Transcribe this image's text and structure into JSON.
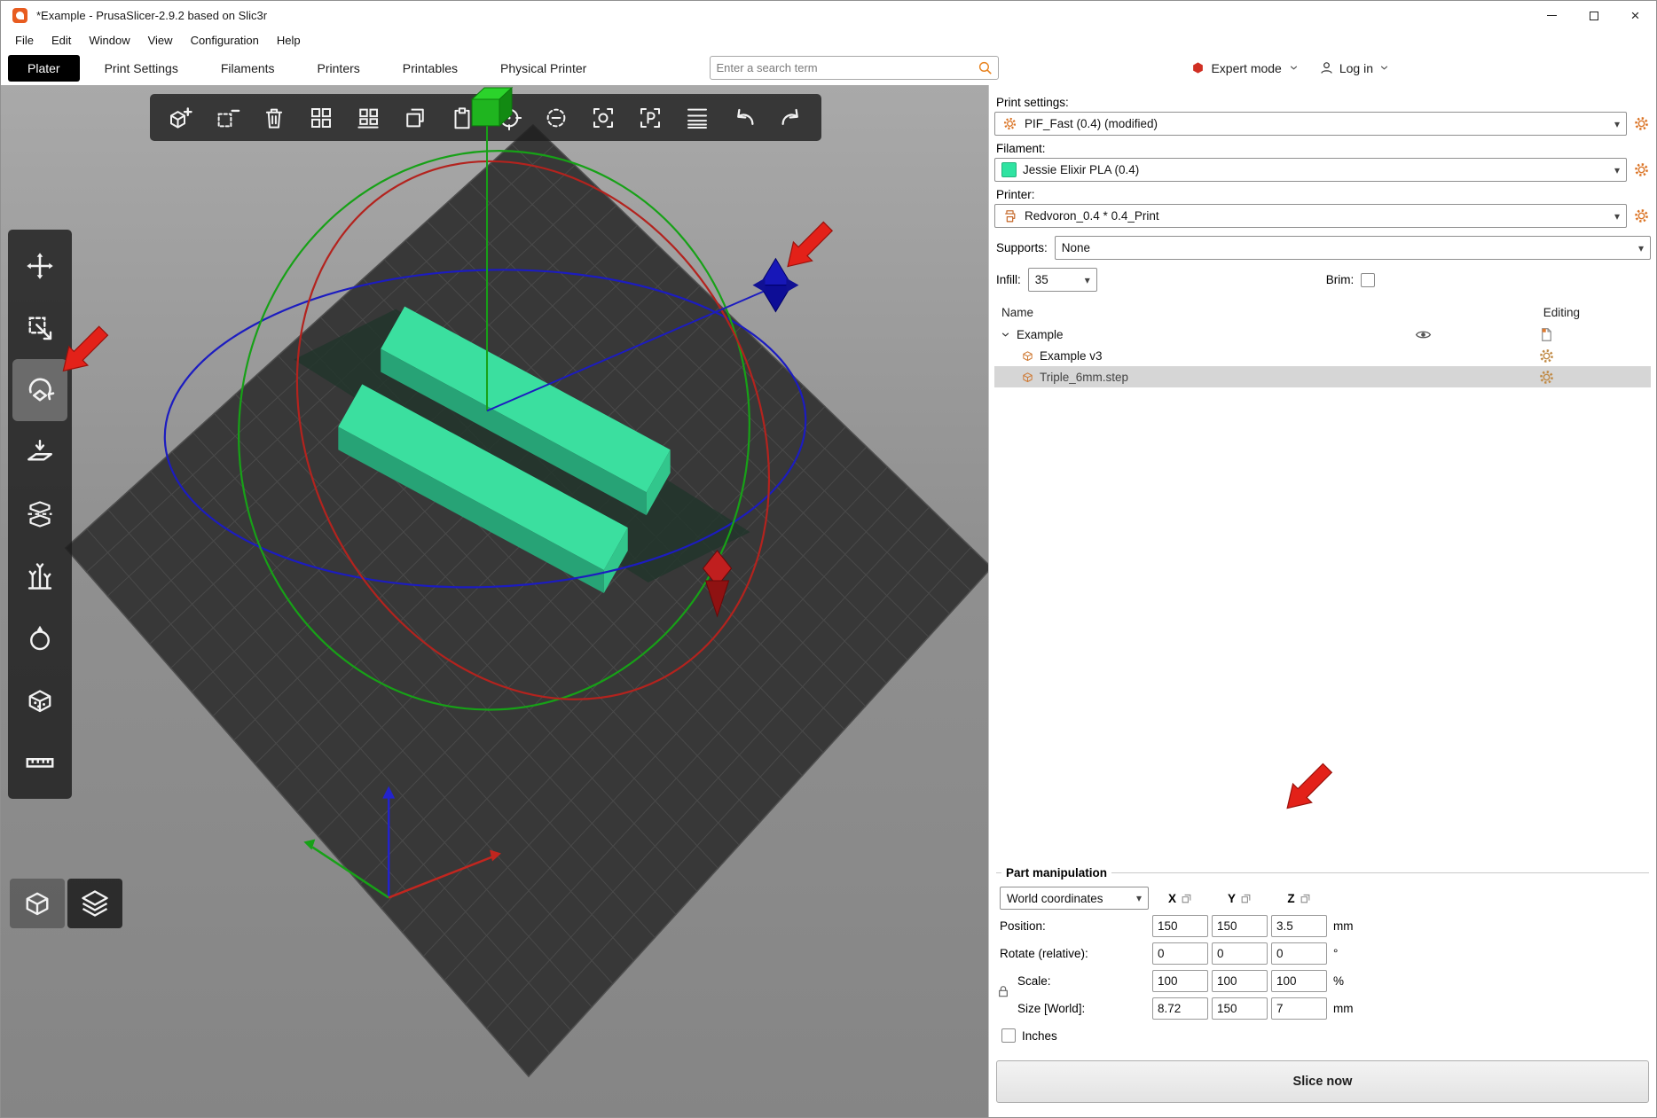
{
  "window": {
    "title": "*Example - PrusaSlicer-2.9.2 based on Slic3r"
  },
  "menubar": {
    "items": [
      "File",
      "Edit",
      "Window",
      "View",
      "Configuration",
      "Help"
    ]
  },
  "header": {
    "tabs": [
      "Plater",
      "Print Settings",
      "Filaments",
      "Printers",
      "Printables",
      "Physical Printer"
    ],
    "active_tab": "Plater",
    "search_placeholder": "Enter a search term",
    "expert_mode_label": "Expert mode",
    "login_label": "Log in"
  },
  "toolbar_top": {
    "icons": [
      "add-object",
      "delete-object",
      "delete-all",
      "arrange",
      "arrange-current-bed",
      "copy",
      "paste",
      "add-instance",
      "remove-instance",
      "split-to-objects",
      "split-to-parts",
      "variable-layer-height",
      "undo",
      "redo"
    ]
  },
  "toolbar_left": {
    "icons": [
      "move",
      "scale",
      "rotate",
      "place-on-face",
      "cut",
      "paint-supports",
      "seam-painting",
      "multimaterial-painting",
      "measure"
    ],
    "active_tool": "rotate"
  },
  "view_buttons": {
    "icons": [
      "3d-editor-view",
      "preview-sliced-layers"
    ]
  },
  "sidebar": {
    "print_settings": {
      "label": "Print settings:",
      "value": "PIF_Fast (0.4) (modified)"
    },
    "filament": {
      "label": "Filament:",
      "value": "Jessie Elixir PLA (0.4)",
      "color": "#2fe3a1"
    },
    "printer": {
      "label": "Printer:",
      "value": "Redvoron_0.4 * 0.4_Print"
    },
    "supports": {
      "label": "Supports:",
      "value": "None"
    },
    "infill": {
      "label": "Infill:",
      "value": "35"
    },
    "brim": {
      "label": "Brim:",
      "checked": false
    },
    "object_list": {
      "headers": {
        "name": "Name",
        "editing": "Editing"
      },
      "rows": [
        {
          "name": "Example",
          "type": "object",
          "expanded": true
        },
        {
          "name": "Example v3",
          "type": "volume"
        },
        {
          "name": "Triple_6mm.step",
          "type": "volume",
          "selected": true
        }
      ]
    }
  },
  "part_manipulation": {
    "title": "Part manipulation",
    "coordinates": "World coordinates",
    "axes": [
      "X",
      "Y",
      "Z"
    ],
    "rows": [
      {
        "label": "Position:",
        "x": "150",
        "y": "150",
        "z": "3.5",
        "unit": "mm"
      },
      {
        "label": "Rotate (relative):",
        "x": "0",
        "y": "0",
        "z": "0",
        "unit": "°"
      },
      {
        "label": "Scale:",
        "x": "100",
        "y": "100",
        "z": "100",
        "unit": "%"
      },
      {
        "label": "Size [World]:",
        "x": "8.72",
        "y": "150",
        "z": "7",
        "unit": "mm"
      }
    ],
    "inches_label": "Inches",
    "inches_checked": false
  },
  "actions": {
    "slice_label": "Slice now"
  },
  "colors": {
    "model": "#3bdf9f",
    "bed": "#383838",
    "grid_line": "#4a4a4a",
    "axis_x_red": "#b3231e",
    "axis_y_green": "#17a117",
    "axis_z_blue": "#1c1cc0",
    "accent_orange": "#e07a2e",
    "expert_red": "#d02f23",
    "annotation_arrow": "#e32119",
    "selected_row": "#d6d6d6"
  }
}
